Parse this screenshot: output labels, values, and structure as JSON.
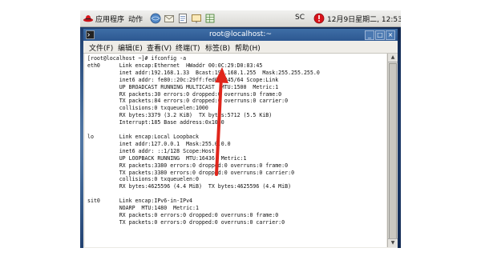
{
  "panel": {
    "apps_label": "应用程序",
    "actions_label": "动作",
    "sc_label": "SC",
    "clock": "12月9日星期二, 12:53"
  },
  "window": {
    "title": "root@localhost:~",
    "menu": [
      "文件(F)",
      "编辑(E)",
      "查看(V)",
      "终端(T)",
      "标签(B)",
      "帮助(H)"
    ]
  },
  "terminal": {
    "lines": [
      "[root@localhost ~]# ifconfig -a",
      "eth0      Link encap:Ethernet  HWaddr 00:0C:29:D0:83:45",
      "          inet addr:192.168.1.33  Bcast:192.168.1.255  Mask:255.255.255.0",
      "          inet6 addr: fe80::20c:29ff:fed0:8345/64 Scope:Link",
      "          UP BROADCAST RUNNING MULTICAST  MTU:1500  Metric:1",
      "          RX packets:30 errors:0 dropped:0 overruns:0 frame:0",
      "          TX packets:84 errors:0 dropped:0 overruns:0 carrier:0",
      "          collisions:0 txqueuelen:1000",
      "          RX bytes:3379 (3.2 KiB)  TX bytes:5712 (5.5 KiB)",
      "          Interrupt:185 Base address:0x1080",
      "",
      "lo        Link encap:Local Loopback",
      "          inet addr:127.0.0.1  Mask:255.0.0.0",
      "          inet6 addr: ::1/128 Scope:Host",
      "          UP LOOPBACK RUNNING  MTU:16436  Metric:1",
      "          RX packets:3380 errors:0 dropped:0 overruns:0 frame:0",
      "          TX packets:3380 errors:0 dropped:0 overruns:0 carrier:0",
      "          collisions:0 txqueuelen:0",
      "          RX bytes:4625596 (4.4 MiB)  TX bytes:4625596 (4.4 MiB)",
      "",
      "sit0      Link encap:IPv6-in-IPv4",
      "          NOARP  MTU:1480  Metric:1",
      "          RX packets:0 errors:0 dropped:0 overruns:0 frame:0",
      "          TX packets:0 errors:0 dropped:0 overruns:0 carrier:0"
    ]
  },
  "colors": {
    "titlebar": "#2d5891",
    "annotation_arrow": "#e0251b",
    "terminal_bg": "#ffffff"
  },
  "icons": [
    "redhat-icon",
    "web-browser-icon",
    "email-icon",
    "office-icon",
    "presentation-icon",
    "spreadsheet-icon",
    "update-alert-icon",
    "terminal-icon"
  ]
}
